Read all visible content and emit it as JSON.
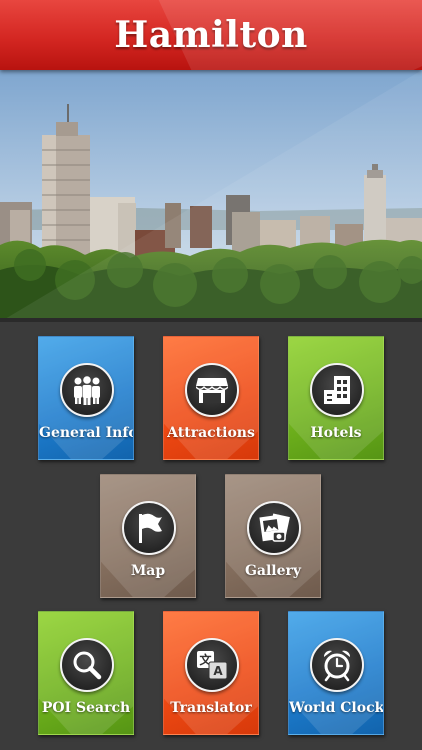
{
  "header": {
    "title": "Hamilton"
  },
  "hero": {
    "image_alt": "Hamilton city skyline"
  },
  "tiles": [
    {
      "label": "General Info",
      "color": "blue",
      "icon": "group-icon"
    },
    {
      "label": "Attractions",
      "color": "orange",
      "icon": "storefront-icon"
    },
    {
      "label": "Hotels",
      "color": "green",
      "icon": "hotel-building-icon"
    },
    {
      "label": "Map",
      "color": "brown",
      "icon": "flag-icon"
    },
    {
      "label": "Gallery",
      "color": "brown",
      "icon": "photos-icon"
    },
    {
      "label": "POI Search",
      "color": "green",
      "icon": "magnifier-icon"
    },
    {
      "label": "Translator",
      "color": "orange",
      "icon": "translate-icon"
    },
    {
      "label": "World Clock",
      "color": "blue",
      "icon": "alarm-clock-icon"
    }
  ],
  "colors": {
    "header_red": "#d42722",
    "tile_blue": "#1d7ccd",
    "tile_orange": "#ef4a14",
    "tile_green": "#6fb21c",
    "tile_brown": "#86705f",
    "background": "#3b3b3b"
  }
}
